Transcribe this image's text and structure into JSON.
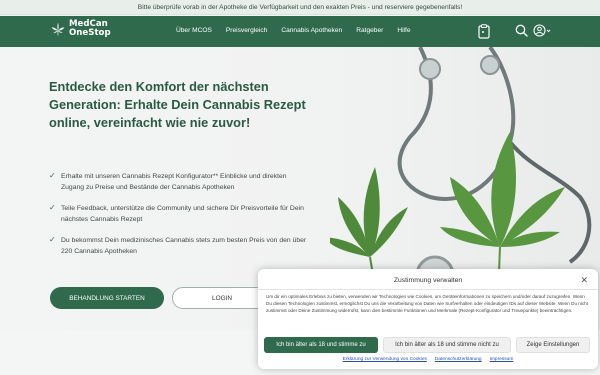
{
  "topbar": {
    "notice": "Bitte überprüfe vorab in der Apotheke die Verfügbarkeit und den exakten Preis - und reserviere gegebenenfalls!"
  },
  "header": {
    "logo": {
      "line1": "MedCan",
      "line2": "OneStop",
      "icon": "cannabis-leaf-icon"
    },
    "menu": [
      "Über MCOS",
      "Preisvergleich",
      "Cannabis Apotheken",
      "Ratgeber",
      "Hilfe"
    ],
    "icons": [
      "clipboard-icon",
      "search-icon",
      "user-icon",
      "chevron-down-icon"
    ]
  },
  "hero": {
    "headline": "Entdecke den Komfort der nächsten Generation: Erhalte Dein Cannabis Rezept online, vereinfacht wie nie zuvor!",
    "bullets": [
      "Erhalte mit unseren Cannabis Rezept Konfigurator** Einblicke und direkten Zugang zu Preise und Bestände der Cannabis Apotheken",
      "Teile Feedback, unterstütze die Community und sichere Dir Preisvorteile für Dein nächstes Cannabis Rezept",
      "Du bekommst Dein medizinisches Cannabis stets zum besten Preis von den über 220 Cannabis Apotheken"
    ],
    "primary_button": "BEHANDLUNG STARTEN",
    "secondary_button": "LOGIN"
  },
  "cookie": {
    "title": "Zustimmung verwalten",
    "text": "Um dir ein optimales Erlebnis zu bieten, verwenden wir Technologien wie Cookies, um Geräteinformationen zu speichern und/oder darauf zuzugreifen. Wenn Du diesen Technologien zustimmst, ermöglichst Du uns die Verarbeitung von Daten wie Surfverhalten oder eindeutigen IDs auf dieser Website. Wenn Du nicht zustimmst oder Deine Zustimmung widerrufst, kann dies bestimmte Funktionen und Merkmale (Rezept-Konfigurator und Treuepunkte) beeinträchtigen.",
    "accept": "Ich bin älter als 18 und stimme zu",
    "decline": "Ich bin älter als 18 und stimme nicht zu",
    "settings": "Zeige Einstellungen",
    "links": [
      "Erklärung zur Verwendung von Cookies",
      "Datenschutzerklärung",
      "Impressum"
    ],
    "close_icon": "close-icon"
  },
  "colors": {
    "brand": "#2f6a4d",
    "link": "#2a4fb0"
  }
}
